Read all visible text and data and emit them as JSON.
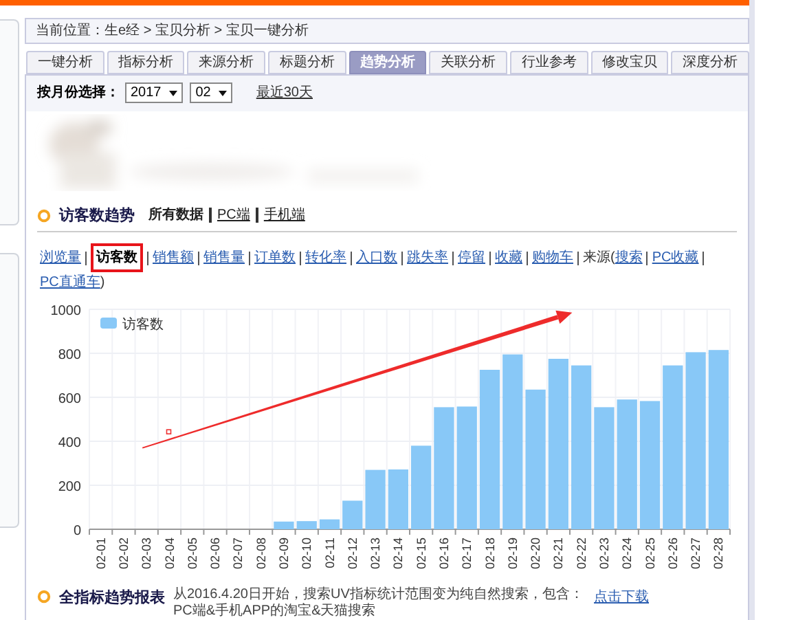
{
  "breadcrumb": "当前位置：生e经 > 宝贝分析 > 宝贝一键分析",
  "tabs": [
    {
      "label": "一键分析",
      "selected": false
    },
    {
      "label": "指标分析",
      "selected": false
    },
    {
      "label": "来源分析",
      "selected": false
    },
    {
      "label": "标题分析",
      "selected": false
    },
    {
      "label": "趋势分析",
      "selected": true
    },
    {
      "label": "关联分析",
      "selected": false
    },
    {
      "label": "行业参考",
      "selected": false
    },
    {
      "label": "修改宝贝",
      "selected": false
    },
    {
      "label": "深度分析",
      "selected": false
    }
  ],
  "month_filter": {
    "label": "按月份选择：",
    "year": "2017",
    "month": "02",
    "link": "最近30天"
  },
  "section": {
    "title": "访客数趋势",
    "filters": [
      {
        "label": "所有数据",
        "selected": true
      },
      {
        "label": "PC端",
        "selected": false
      },
      {
        "label": "手机端",
        "selected": false
      }
    ]
  },
  "metrics": [
    {
      "label": "浏览量",
      "selected": false
    },
    {
      "label": "访客数",
      "selected": true
    },
    {
      "label": "销售额",
      "selected": false
    },
    {
      "label": "销售量",
      "selected": false
    },
    {
      "label": "订单数",
      "selected": false
    },
    {
      "label": "转化率",
      "selected": false
    },
    {
      "label": "入口数",
      "selected": false
    },
    {
      "label": "跳失率",
      "selected": false
    },
    {
      "label": "停留",
      "selected": false
    },
    {
      "label": "收藏",
      "selected": false
    },
    {
      "label": "购物车",
      "selected": false
    }
  ],
  "source": {
    "label": "来源(",
    "links": [
      "搜索",
      "PC收藏",
      "PC直通车"
    ],
    "close": ")"
  },
  "chart_data": {
    "type": "bar",
    "categories": [
      "02-01",
      "02-02",
      "02-03",
      "02-04",
      "02-05",
      "02-06",
      "02-07",
      "02-08",
      "02-09",
      "02-10",
      "02-11",
      "02-12",
      "02-13",
      "02-14",
      "02-15",
      "02-16",
      "02-17",
      "02-18",
      "02-19",
      "02-20",
      "02-21",
      "02-22",
      "02-23",
      "02-24",
      "02-25",
      "02-26",
      "02-27",
      "02-28"
    ],
    "series": [
      {
        "name": "访客数",
        "color": "#88c8f7",
        "values": [
          0,
          0,
          0,
          0,
          0,
          0,
          0,
          0,
          35,
          37,
          45,
          130,
          270,
          272,
          380,
          555,
          558,
          725,
          795,
          635,
          775,
          745,
          555,
          590,
          583,
          745,
          805,
          815
        ]
      }
    ],
    "grid": true,
    "ylim": [
      0,
      1000
    ],
    "yticks": [
      0,
      200,
      400,
      600,
      800,
      1000
    ]
  },
  "footer": {
    "title": "全指标趋势报表",
    "note": "从2016.4.20日开始，搜索UV指标统计范围变为纯自然搜索，包含：PC端&手机APP的淘宝&天猫搜索",
    "link": "点击下载"
  }
}
